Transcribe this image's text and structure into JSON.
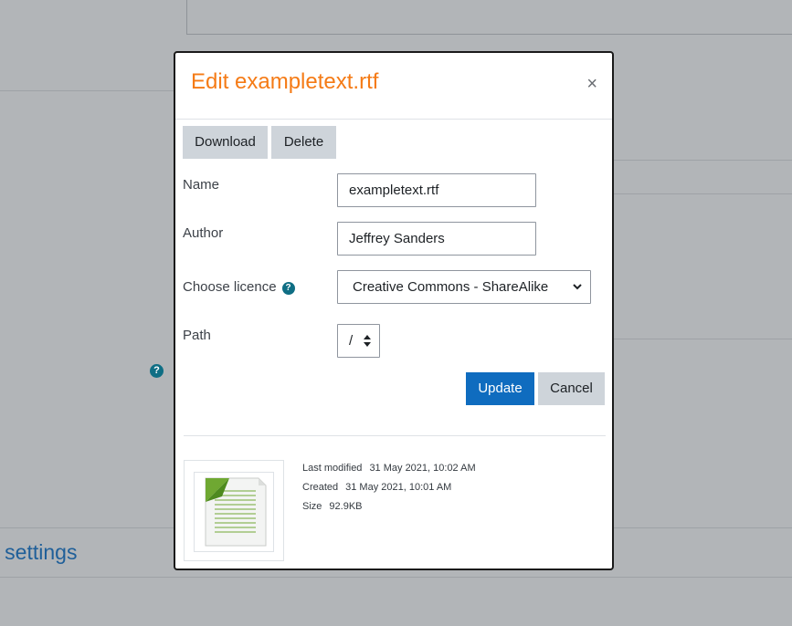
{
  "background": {
    "settings_text": "e settings",
    "help_icon": "?"
  },
  "dialog": {
    "title": "Edit exampletext.rtf",
    "close_icon": "×",
    "download_label": "Download",
    "delete_label": "Delete",
    "name_label": "Name",
    "name_value": "exampletext.rtf",
    "author_label": "Author",
    "author_value": "Jeffrey Sanders",
    "licence_label": "Choose licence",
    "licence_help_icon": "?",
    "licence_value": "Creative Commons - ShareAlike",
    "path_label": "Path",
    "path_value": "/",
    "update_label": "Update",
    "cancel_label": "Cancel",
    "last_modified_label": "Last modified",
    "last_modified_value": "31 May 2021, 10:02 AM",
    "created_label": "Created",
    "created_value": "31 May 2021, 10:01 AM",
    "size_label": "Size",
    "size_value": "92.9KB"
  },
  "colors": {
    "title": "#f57b16",
    "primary": "#0f6cbf",
    "help": "#0f6e84"
  }
}
